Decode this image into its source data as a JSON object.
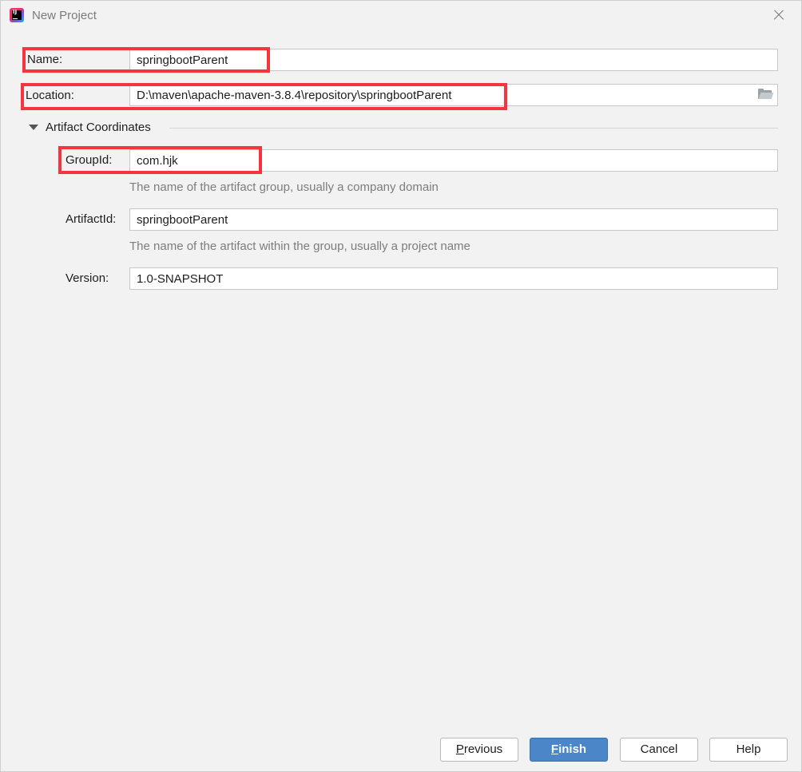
{
  "window": {
    "title": "New Project"
  },
  "form": {
    "name": {
      "label": "Name:",
      "value": "springbootParent"
    },
    "location": {
      "label": "Location:",
      "value": "D:\\maven\\apache-maven-3.8.4\\repository\\springbootParent"
    },
    "artifact_coordinates": {
      "section_title": "Artifact Coordinates",
      "group_id": {
        "label": "GroupId:",
        "value": "com.hjk",
        "hint": "The name of the artifact group, usually a company domain"
      },
      "artifact_id": {
        "label": "ArtifactId:",
        "value": "springbootParent",
        "hint": "The name of the artifact within the group, usually a project name"
      },
      "version": {
        "label": "Version:",
        "value": "1.0-SNAPSHOT"
      }
    }
  },
  "buttons": {
    "previous": {
      "mnemonic": "P",
      "rest": "revious"
    },
    "finish": {
      "mnemonic": "F",
      "rest": "inish"
    },
    "cancel": {
      "label": "Cancel"
    },
    "help": {
      "label": "Help"
    }
  },
  "colors": {
    "highlight": "#f4343e",
    "primary_button": "#4a86c8",
    "background": "#f2f2f2"
  },
  "icons": {
    "app": "intellij-idea-icon",
    "close": "close-icon",
    "browse": "folder-icon",
    "toggle": "triangle-down-icon"
  }
}
